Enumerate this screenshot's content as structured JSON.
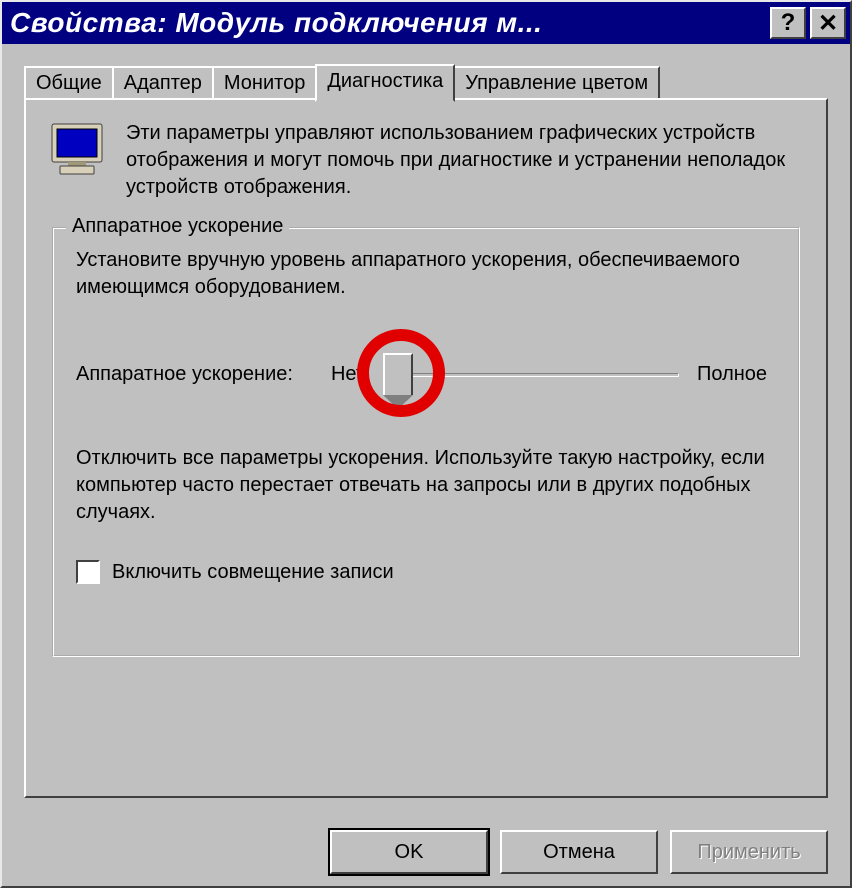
{
  "window": {
    "title": "Свойства: Модуль подключения м..."
  },
  "tabs": {
    "items": [
      {
        "label": "Общие"
      },
      {
        "label": "Адаптер"
      },
      {
        "label": "Монитор"
      },
      {
        "label": "Диагностика"
      },
      {
        "label": "Управление цветом"
      }
    ],
    "active_index": 3
  },
  "intro_text": "Эти параметры управляют использованием графических устройств отображения и могут помочь при диагностике и устранении неполадок устройств отображения.",
  "group": {
    "legend": "Аппаратное ускорение",
    "intro": "Установите вручную уровень аппаратного ускорения, обеспечиваемого имеющимся оборудованием.",
    "slider": {
      "label": "Аппаратное ускорение:",
      "left_label": "Нет",
      "right_label": "Полное",
      "position": 0,
      "max": 5
    },
    "description": "Отключить все параметры ускорения. Используйте такую настройку, если компьютер часто перестает отвечать на запросы или в других подобных случаях.",
    "checkbox": {
      "checked": false,
      "label": "Включить совмещение записи"
    }
  },
  "buttons": {
    "ok": "OK",
    "cancel": "Отмена",
    "apply": "Применить"
  },
  "icons": {
    "help": "?",
    "close": "✕",
    "monitor": "monitor-icon"
  }
}
